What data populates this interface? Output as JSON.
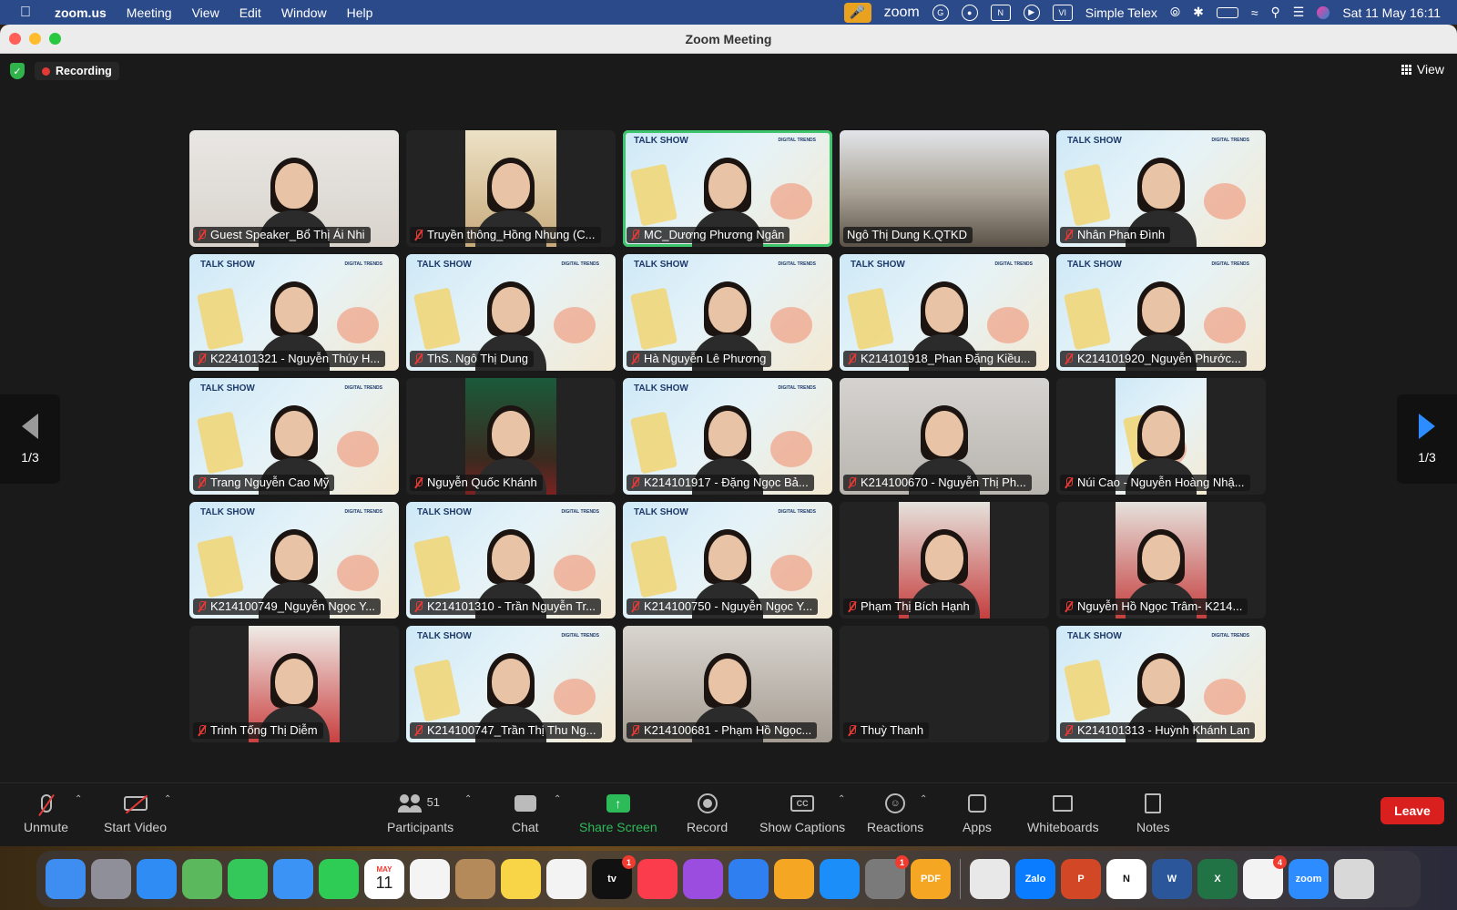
{
  "menubar": {
    "app_name": "zoom.us",
    "menus": [
      "Meeting",
      "View",
      "Edit",
      "Window",
      "Help"
    ],
    "zoom_label": "zoom",
    "input_label": "Simple Telex",
    "datetime": "Sat 11 May  16:11"
  },
  "window": {
    "title": "Zoom Meeting"
  },
  "meeting": {
    "recording_label": "Recording",
    "view_label": "View",
    "page_indicator": "1/3"
  },
  "participants": [
    {
      "name": "Guest Speaker_Bổ Thị Ái Nhi",
      "muted": true,
      "bg": "light"
    },
    {
      "name": "Truyền thông_Hồng Nhung (C...",
      "muted": true,
      "bg": "dark-inset-warm"
    },
    {
      "name": "MC_Dương Phương Ngân",
      "muted": true,
      "bg": "talk",
      "active": true
    },
    {
      "name": "Ngô Thị Dung K.QTKD",
      "muted": false,
      "bg": "room"
    },
    {
      "name": "Nhân Phan Đình",
      "muted": true,
      "bg": "talk"
    },
    {
      "name": "K224101321 - Nguyễn Thúy H...",
      "muted": true,
      "bg": "talk"
    },
    {
      "name": "ThS. Ngô Thị Dung",
      "muted": true,
      "bg": "talk"
    },
    {
      "name": "Hà Nguyễn Lê Phương",
      "muted": true,
      "bg": "talk"
    },
    {
      "name": "K214101918_Phan Đặng Kiều...",
      "muted": true,
      "bg": "talk"
    },
    {
      "name": "K214101920_Nguyễn Phước...",
      "muted": true,
      "bg": "talk"
    },
    {
      "name": "Trang Nguyễn Cao Mỹ",
      "muted": true,
      "bg": "talk"
    },
    {
      "name": "Nguyễn Quốc Khánh",
      "muted": true,
      "bg": "dark-inset-green"
    },
    {
      "name": "K214101917 -  Đặng Ngọc Bả...",
      "muted": true,
      "bg": "talk"
    },
    {
      "name": "K214100670 - Nguyễn Thị Ph...",
      "muted": true,
      "bg": "grey"
    },
    {
      "name": "Núi Cao - Nguyễn Hoàng Nhậ...",
      "muted": true,
      "bg": "dark-inset-talk"
    },
    {
      "name": "K214100749_Nguyễn Ngọc Y...",
      "muted": true,
      "bg": "talk"
    },
    {
      "name": "K214101310 - Trần Nguyễn Tr...",
      "muted": true,
      "bg": "talk"
    },
    {
      "name": "K214100750 - Nguyễn Ngọc Y...",
      "muted": true,
      "bg": "talk"
    },
    {
      "name": "Phạm Thị Bích Hạnh",
      "muted": true,
      "bg": "dark-inset-red"
    },
    {
      "name": "Nguyễn Hồ Ngọc Trâm- K214...",
      "muted": true,
      "bg": "dark-inset-red"
    },
    {
      "name": "Trinh Tống Thị Diễm",
      "muted": true,
      "bg": "dark-inset-cream"
    },
    {
      "name": "K214100747_Trần Thị Thu Ng...",
      "muted": true,
      "bg": "talk"
    },
    {
      "name": "K214100681 - Phạm Hồ Ngọc...",
      "muted": true,
      "bg": "hood"
    },
    {
      "name": "Thuỳ Thanh",
      "muted": true,
      "bg": "dark"
    },
    {
      "name": "K214101313 - Huỳnh Khánh Lan",
      "muted": true,
      "bg": "talk"
    }
  ],
  "talkshow": {
    "logo": "TALK SHOW",
    "tag": "DIGITAL TRENDS"
  },
  "toolbar": {
    "unmute": "Unmute",
    "start_video": "Start Video",
    "participants": "Participants",
    "participant_count": "51",
    "chat": "Chat",
    "share_screen": "Share Screen",
    "record": "Record",
    "show_captions": "Show Captions",
    "captions_icon_text": "CC",
    "reactions": "Reactions",
    "apps": "Apps",
    "whiteboards": "Whiteboards",
    "notes": "Notes",
    "leave": "Leave"
  },
  "dock": {
    "calendar_month": "MAY",
    "calendar_day": "11",
    "apps": [
      {
        "name": "finder",
        "color": "#3d8ef0"
      },
      {
        "name": "launchpad",
        "color": "#8f8f9a"
      },
      {
        "name": "safari",
        "color": "#2f8cf5"
      },
      {
        "name": "maps",
        "color": "#5cb85c"
      },
      {
        "name": "messages",
        "color": "#34c759"
      },
      {
        "name": "mail",
        "color": "#3b93f5"
      },
      {
        "name": "facetime",
        "color": "#2ecc55"
      },
      {
        "name": "calendar",
        "color": "#ffffff"
      },
      {
        "name": "reminders",
        "color": "#f4f4f4"
      },
      {
        "name": "contacts",
        "color": "#b58a5a"
      },
      {
        "name": "notes",
        "color": "#f7d547"
      },
      {
        "name": "freeform",
        "color": "#f3f3f3"
      },
      {
        "name": "apple-tv",
        "color": "#111111",
        "badge": "1",
        "label": "tv"
      },
      {
        "name": "music",
        "color": "#fa3c4c"
      },
      {
        "name": "podcasts",
        "color": "#9b4de0"
      },
      {
        "name": "keynote",
        "color": "#2f7ff0"
      },
      {
        "name": "pages",
        "color": "#f5a623"
      },
      {
        "name": "app-store",
        "color": "#1c8ef9"
      },
      {
        "name": "system-settings",
        "color": "#7a7a7a",
        "badge": "1"
      },
      {
        "name": "pdf-app",
        "color": "#f5a623",
        "label": "PDF"
      }
    ],
    "apps2": [
      {
        "name": "chrome",
        "color": "#e8e8e8"
      },
      {
        "name": "zalo",
        "color": "#0a7cff",
        "label": "Zalo"
      },
      {
        "name": "powerpoint",
        "color": "#d24726",
        "label": "P"
      },
      {
        "name": "notion",
        "color": "#ffffff",
        "label": "N"
      },
      {
        "name": "word",
        "color": "#2b579a",
        "label": "W"
      },
      {
        "name": "excel",
        "color": "#217346",
        "label": "X"
      },
      {
        "name": "office",
        "color": "#f3f3f3",
        "badge": "4"
      },
      {
        "name": "zoom",
        "color": "#2d8cff",
        "label": "zoom"
      },
      {
        "name": "trash",
        "color": "#d8d8d8"
      }
    ]
  }
}
